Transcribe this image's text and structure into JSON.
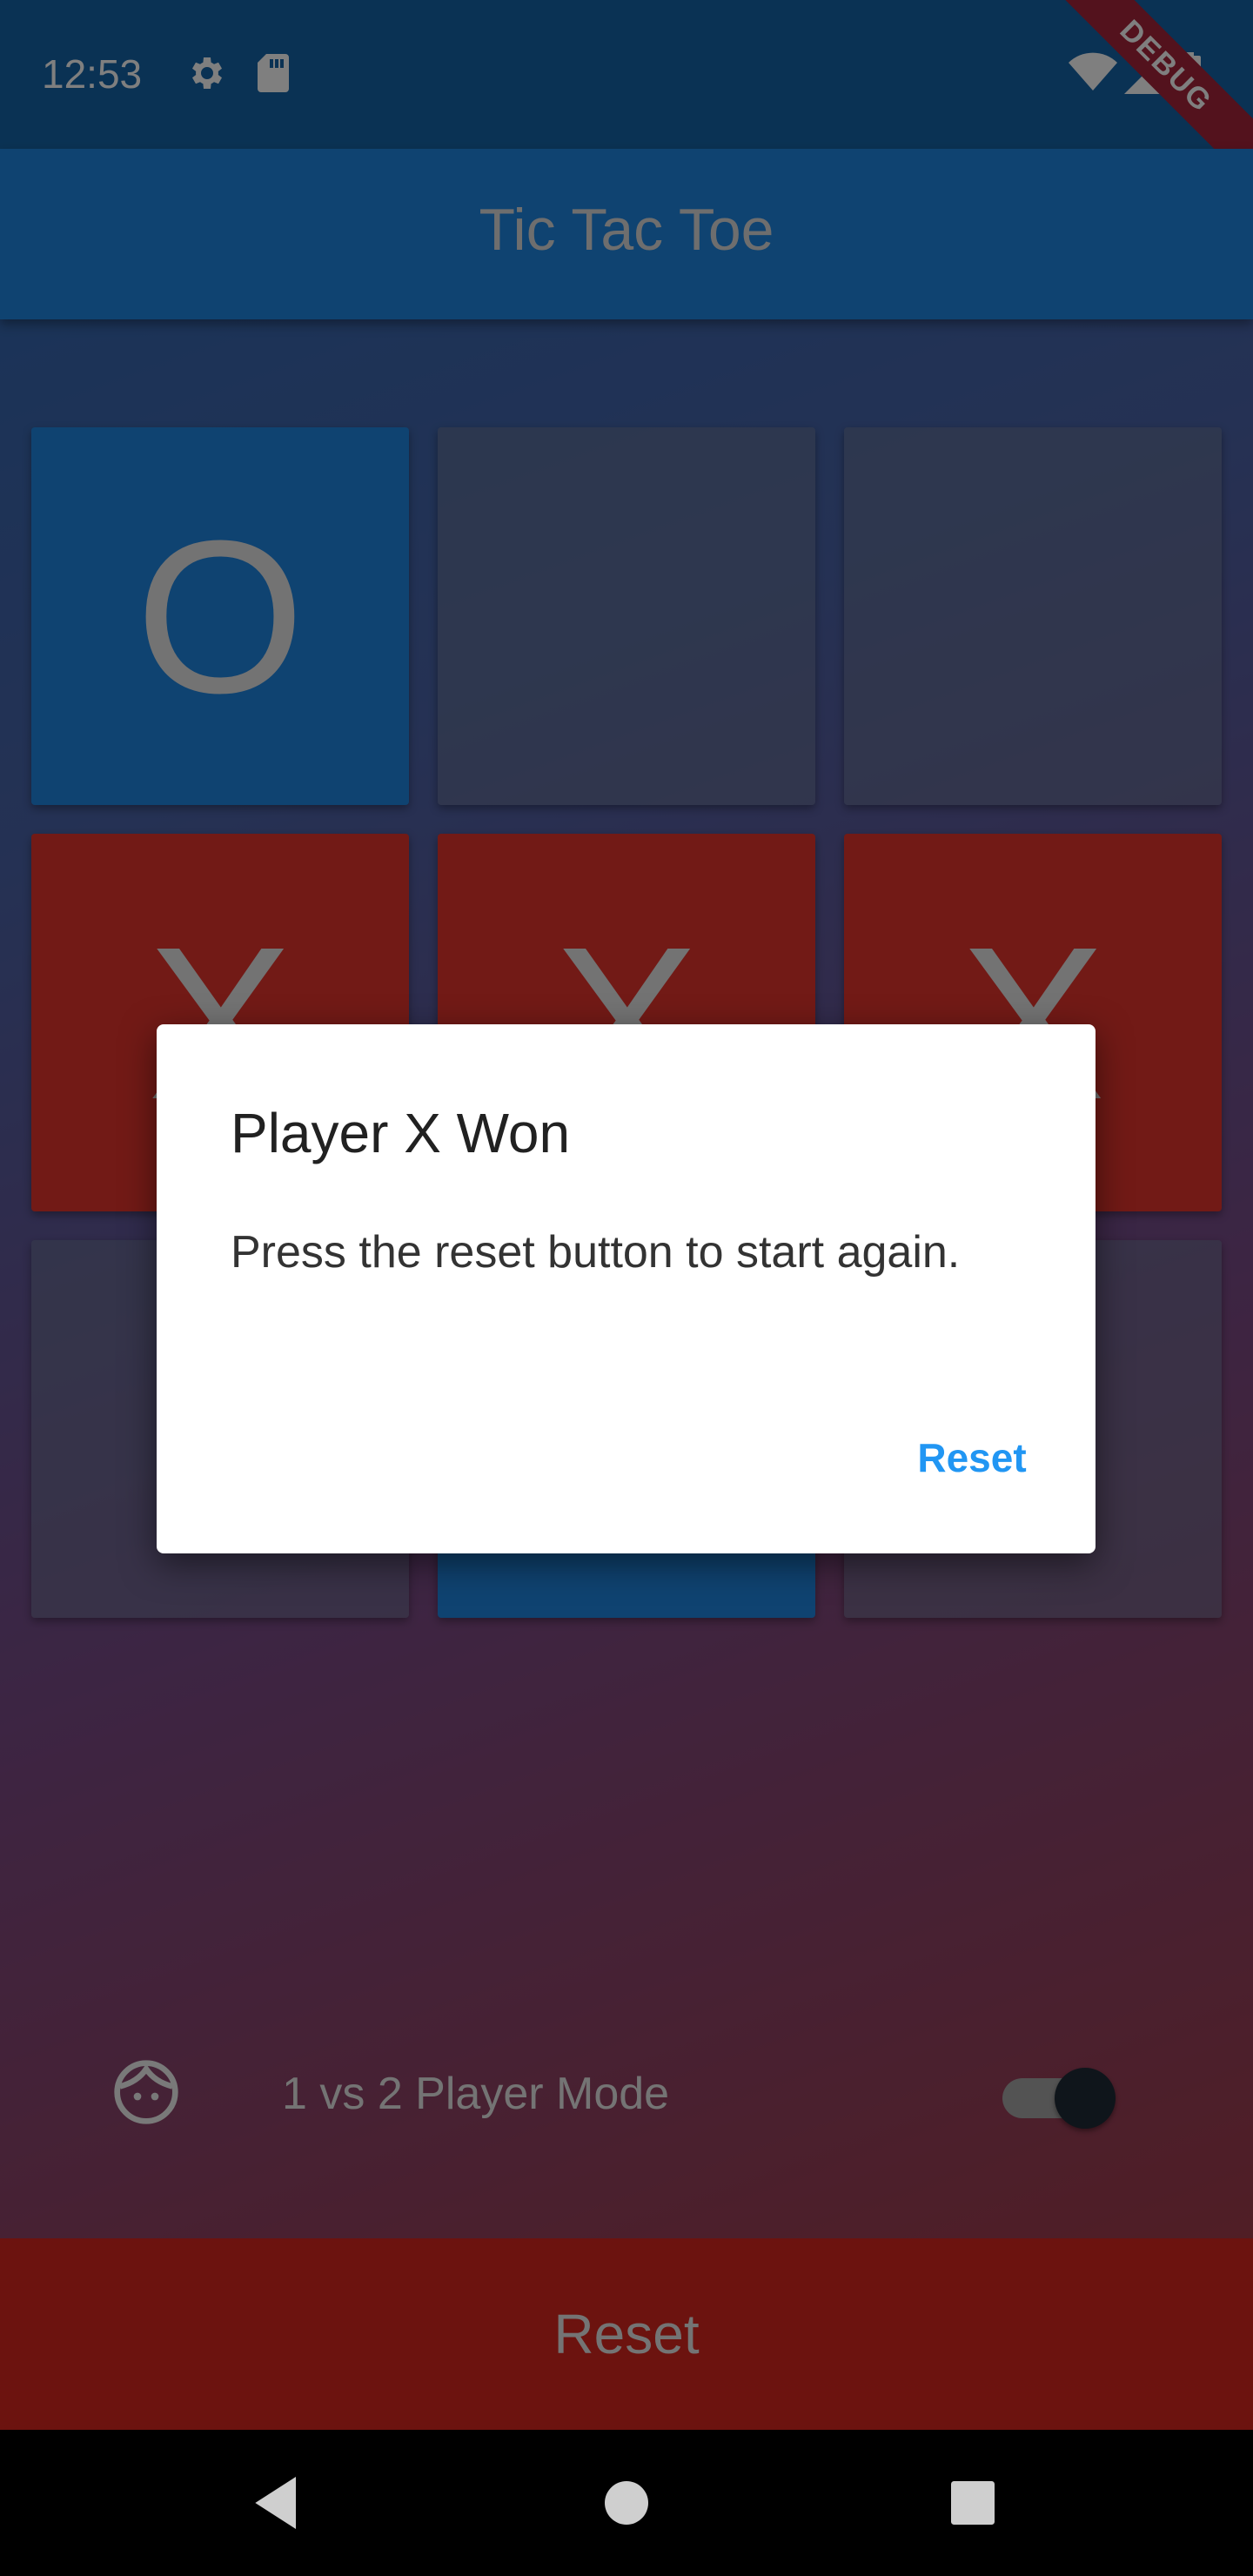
{
  "status_bar": {
    "time": "12:53",
    "left_icons": [
      "gear-icon",
      "sd-card-icon"
    ],
    "right_icons": [
      "wifi-icon",
      "signal-icon",
      "battery-icon"
    ],
    "debug_label": "DEBUG"
  },
  "app_bar": {
    "title": "Tic Tac Toe"
  },
  "board": {
    "cells": [
      {
        "mark": "O",
        "state": "O"
      },
      {
        "mark": "",
        "state": "E"
      },
      {
        "mark": "",
        "state": "E"
      },
      {
        "mark": "X",
        "state": "X"
      },
      {
        "mark": "X",
        "state": "X"
      },
      {
        "mark": "X",
        "state": "X"
      },
      {
        "mark": "",
        "state": "E"
      },
      {
        "mark": "",
        "state": "O"
      },
      {
        "mark": "",
        "state": "E"
      }
    ]
  },
  "mode": {
    "icon": "face-icon",
    "label": "1 vs 2 Player Mode",
    "switch_on": true
  },
  "footer": {
    "reset_label": "Reset"
  },
  "dialog": {
    "title": "Player X Won",
    "body": "Press the reset button to start again.",
    "button_label": "Reset"
  },
  "nav_bar": {
    "buttons": [
      "back-icon",
      "home-icon",
      "recents-icon"
    ]
  },
  "colors": {
    "o_cell": "#1f86e3",
    "x_cell": "#e4352d",
    "accent": "#2196f3",
    "reset_bar": "#d8261e"
  }
}
